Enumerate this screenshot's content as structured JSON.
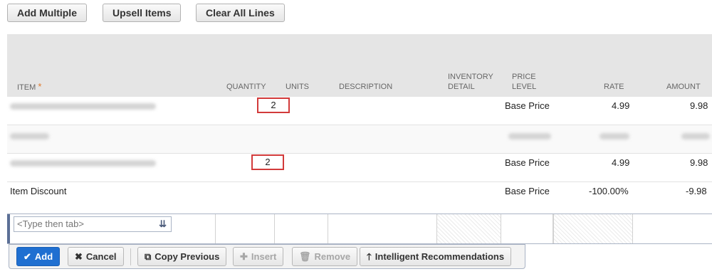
{
  "toolbar": {
    "add_multiple": "Add Multiple",
    "upsell_items": "Upsell Items",
    "clear_all_lines": "Clear All Lines"
  },
  "columns": {
    "item": "ITEM",
    "required_mark": "*",
    "quantity": "QUANTITY",
    "units": "UNITS",
    "description": "DESCRIPTION",
    "inventory_detail_1": "INVENTORY",
    "inventory_detail_2": "DETAIL",
    "price_level_1": "PRICE",
    "price_level_2": "LEVEL",
    "rate": "RATE",
    "amount": "AMOUNT"
  },
  "rows": [
    {
      "quantity": "2",
      "price_level": "Base Price",
      "rate": "4.99",
      "amount": "9.98"
    },
    {
      "quantity": "",
      "price_level": "",
      "rate": "",
      "amount": ""
    },
    {
      "quantity": "2",
      "price_level": "Base Price",
      "rate": "4.99",
      "amount": "9.98"
    },
    {
      "item": "Item Discount",
      "price_level": "Base Price",
      "rate": "-100.00%",
      "amount": "-9.98"
    }
  ],
  "edit_row": {
    "item_placeholder": "<Type then tab>"
  },
  "actions": {
    "add": "Add",
    "cancel": "Cancel",
    "copy_previous": "Copy Previous",
    "insert": "Insert",
    "remove": "Remove",
    "intelligent_recommendations": "Intelligent Recommendations"
  },
  "colors": {
    "primary": "#1f6fd1",
    "highlight": "#d23a3a",
    "required": "#e07a2e"
  }
}
